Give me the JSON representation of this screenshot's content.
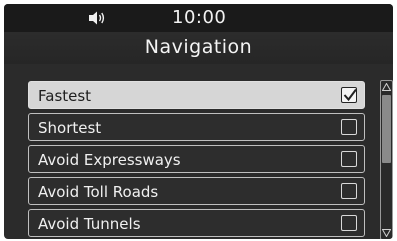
{
  "status_bar": {
    "volume_icon": "speaker-volume-icon",
    "time": "10:00"
  },
  "header": {
    "title": "Navigation"
  },
  "options": [
    {
      "label": "Fastest",
      "checked": true
    },
    {
      "label": "Shortest",
      "checked": false
    },
    {
      "label": "Avoid Expressways",
      "checked": false
    },
    {
      "label": "Avoid Toll Roads",
      "checked": false
    },
    {
      "label": "Avoid Tunnels",
      "checked": false
    }
  ],
  "scrollbar": {
    "up_icon": "scroll-up-arrow-icon",
    "down_icon": "scroll-down-arrow-icon"
  },
  "colors": {
    "background": "#2b2b2b",
    "selected_row": "#d6d6d6",
    "text": "#f0f0f0"
  }
}
